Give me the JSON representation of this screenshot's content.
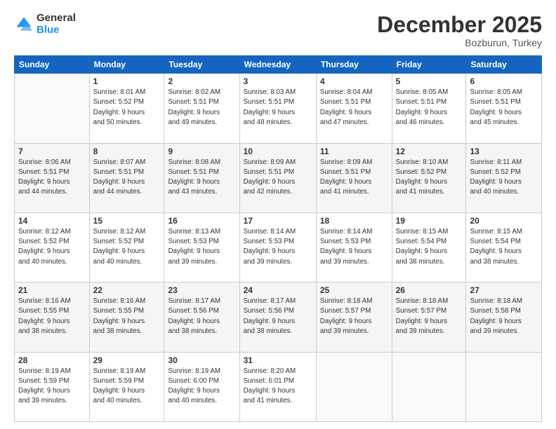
{
  "header": {
    "logo": {
      "general": "General",
      "blue": "Blue"
    },
    "title": "December 2025",
    "subtitle": "Bozburun, Turkey"
  },
  "weekdays": [
    "Sunday",
    "Monday",
    "Tuesday",
    "Wednesday",
    "Thursday",
    "Friday",
    "Saturday"
  ],
  "weeks": [
    [
      {
        "day": "",
        "info": ""
      },
      {
        "day": "1",
        "info": "Sunrise: 8:01 AM\nSunset: 5:52 PM\nDaylight: 9 hours\nand 50 minutes."
      },
      {
        "day": "2",
        "info": "Sunrise: 8:02 AM\nSunset: 5:51 PM\nDaylight: 9 hours\nand 49 minutes."
      },
      {
        "day": "3",
        "info": "Sunrise: 8:03 AM\nSunset: 5:51 PM\nDaylight: 9 hours\nand 48 minutes."
      },
      {
        "day": "4",
        "info": "Sunrise: 8:04 AM\nSunset: 5:51 PM\nDaylight: 9 hours\nand 47 minutes."
      },
      {
        "day": "5",
        "info": "Sunrise: 8:05 AM\nSunset: 5:51 PM\nDaylight: 9 hours\nand 46 minutes."
      },
      {
        "day": "6",
        "info": "Sunrise: 8:05 AM\nSunset: 5:51 PM\nDaylight: 9 hours\nand 45 minutes."
      }
    ],
    [
      {
        "day": "7",
        "info": "Sunrise: 8:06 AM\nSunset: 5:51 PM\nDaylight: 9 hours\nand 44 minutes."
      },
      {
        "day": "8",
        "info": "Sunrise: 8:07 AM\nSunset: 5:51 PM\nDaylight: 9 hours\nand 44 minutes."
      },
      {
        "day": "9",
        "info": "Sunrise: 8:08 AM\nSunset: 5:51 PM\nDaylight: 9 hours\nand 43 minutes."
      },
      {
        "day": "10",
        "info": "Sunrise: 8:09 AM\nSunset: 5:51 PM\nDaylight: 9 hours\nand 42 minutes."
      },
      {
        "day": "11",
        "info": "Sunrise: 8:09 AM\nSunset: 5:51 PM\nDaylight: 9 hours\nand 41 minutes."
      },
      {
        "day": "12",
        "info": "Sunrise: 8:10 AM\nSunset: 5:52 PM\nDaylight: 9 hours\nand 41 minutes."
      },
      {
        "day": "13",
        "info": "Sunrise: 8:11 AM\nSunset: 5:52 PM\nDaylight: 9 hours\nand 40 minutes."
      }
    ],
    [
      {
        "day": "14",
        "info": "Sunrise: 8:12 AM\nSunset: 5:52 PM\nDaylight: 9 hours\nand 40 minutes."
      },
      {
        "day": "15",
        "info": "Sunrise: 8:12 AM\nSunset: 5:52 PM\nDaylight: 9 hours\nand 40 minutes."
      },
      {
        "day": "16",
        "info": "Sunrise: 8:13 AM\nSunset: 5:53 PM\nDaylight: 9 hours\nand 39 minutes."
      },
      {
        "day": "17",
        "info": "Sunrise: 8:14 AM\nSunset: 5:53 PM\nDaylight: 9 hours\nand 39 minutes."
      },
      {
        "day": "18",
        "info": "Sunrise: 8:14 AM\nSunset: 5:53 PM\nDaylight: 9 hours\nand 39 minutes."
      },
      {
        "day": "19",
        "info": "Sunrise: 8:15 AM\nSunset: 5:54 PM\nDaylight: 9 hours\nand 38 minutes."
      },
      {
        "day": "20",
        "info": "Sunrise: 8:15 AM\nSunset: 5:54 PM\nDaylight: 9 hours\nand 38 minutes."
      }
    ],
    [
      {
        "day": "21",
        "info": "Sunrise: 8:16 AM\nSunset: 5:55 PM\nDaylight: 9 hours\nand 38 minutes."
      },
      {
        "day": "22",
        "info": "Sunrise: 8:16 AM\nSunset: 5:55 PM\nDaylight: 9 hours\nand 38 minutes."
      },
      {
        "day": "23",
        "info": "Sunrise: 8:17 AM\nSunset: 5:56 PM\nDaylight: 9 hours\nand 38 minutes."
      },
      {
        "day": "24",
        "info": "Sunrise: 8:17 AM\nSunset: 5:56 PM\nDaylight: 9 hours\nand 38 minutes."
      },
      {
        "day": "25",
        "info": "Sunrise: 8:18 AM\nSunset: 5:57 PM\nDaylight: 9 hours\nand 39 minutes."
      },
      {
        "day": "26",
        "info": "Sunrise: 8:18 AM\nSunset: 5:57 PM\nDaylight: 9 hours\nand 39 minutes."
      },
      {
        "day": "27",
        "info": "Sunrise: 8:18 AM\nSunset: 5:58 PM\nDaylight: 9 hours\nand 39 minutes."
      }
    ],
    [
      {
        "day": "28",
        "info": "Sunrise: 8:19 AM\nSunset: 5:59 PM\nDaylight: 9 hours\nand 39 minutes."
      },
      {
        "day": "29",
        "info": "Sunrise: 8:19 AM\nSunset: 5:59 PM\nDaylight: 9 hours\nand 40 minutes."
      },
      {
        "day": "30",
        "info": "Sunrise: 8:19 AM\nSunset: 6:00 PM\nDaylight: 9 hours\nand 40 minutes."
      },
      {
        "day": "31",
        "info": "Sunrise: 8:20 AM\nSunset: 6:01 PM\nDaylight: 9 hours\nand 41 minutes."
      },
      {
        "day": "",
        "info": ""
      },
      {
        "day": "",
        "info": ""
      },
      {
        "day": "",
        "info": ""
      }
    ]
  ]
}
